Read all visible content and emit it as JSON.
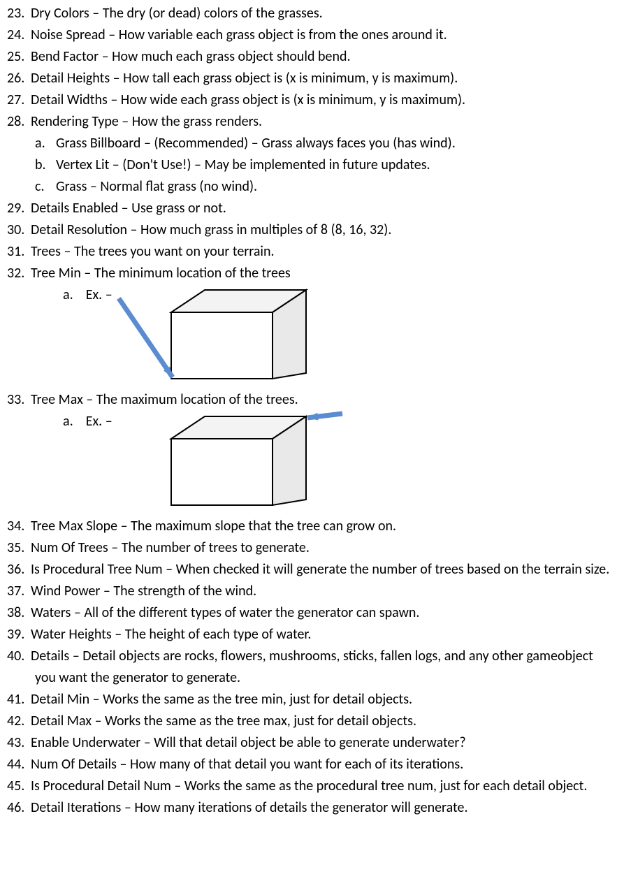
{
  "items": [
    {
      "n": "23.",
      "t": "Dry Colors – The dry (or dead) colors of the grasses."
    },
    {
      "n": "24.",
      "t": "Noise Spread – How variable each grass object is from the ones around it."
    },
    {
      "n": "25.",
      "t": "Bend Factor – How much each grass object should bend."
    },
    {
      "n": "26.",
      "t": "Detail Heights – How tall each grass object is (x is minimum, y is maximum)."
    },
    {
      "n": "27.",
      "t": "Detail Widths – How wide each grass object is (x is minimum, y is maximum)."
    },
    {
      "n": "28.",
      "t": "Rendering Type – How the grass renders.",
      "sub": [
        {
          "n": "a.",
          "t": "Grass Billboard – (Recommended) – Grass always faces you (has wind)."
        },
        {
          "n": "b.",
          "t": "Vertex Lit – (Don't Use!) – May be implemented in future updates."
        },
        {
          "n": "c.",
          "t": "Grass – Normal flat grass (no wind)."
        }
      ]
    },
    {
      "n": "29.",
      "t": "Details Enabled – Use grass or not."
    },
    {
      "n": "30.",
      "t": "Detail Resolution – How much grass in multiples of 8 (8, 16, 32)."
    },
    {
      "n": "31.",
      "t": "Trees – The trees you want on your terrain."
    },
    {
      "n": "32.",
      "t": "Tree Min – The minimum location of the trees",
      "fig": "min",
      "sub_lead": "a.    Ex. –"
    },
    {
      "n": "33.",
      "t": "Tree Max – The maximum location of the trees.",
      "fig": "max",
      "sub_lead": "a.    Ex. –"
    },
    {
      "n": "34.",
      "t": "Tree Max Slope – The maximum slope that the tree can grow on."
    },
    {
      "n": "35.",
      "t": "Num Of Trees – The number of trees to generate."
    },
    {
      "n": "36.",
      "t": "Is Procedural Tree Num – When checked it will generate the number of trees based on the terrain size."
    },
    {
      "n": "37.",
      "t": "Wind Power – The strength of the wind."
    },
    {
      "n": "38.",
      "t": "Waters – All of the different types of water the generator can spawn."
    },
    {
      "n": "39.",
      "t": "Water Heights – The height of each type of water."
    },
    {
      "n": "40.",
      "t": "Details – Detail objects are rocks, flowers, mushrooms, sticks, fallen logs, and any other gameobject you want the generator to generate."
    },
    {
      "n": "41.",
      "t": "Detail Min – Works the same as the tree min, just for detail objects."
    },
    {
      "n": "42.",
      "t": "Detail Max – Works the same as the tree max, just for detail objects."
    },
    {
      "n": "43.",
      "t": "Enable Underwater – Will that detail object be able to generate underwater?"
    },
    {
      "n": "44.",
      "t": "Num Of Details – How many of that detail you want for each of its iterations."
    },
    {
      "n": "45.",
      "t": "Is Procedural Detail Num – Works the same as the procedural tree num, just for each detail object."
    },
    {
      "n": "46.",
      "t": "Detail Iterations – How many iterations of details the generator will generate."
    }
  ]
}
